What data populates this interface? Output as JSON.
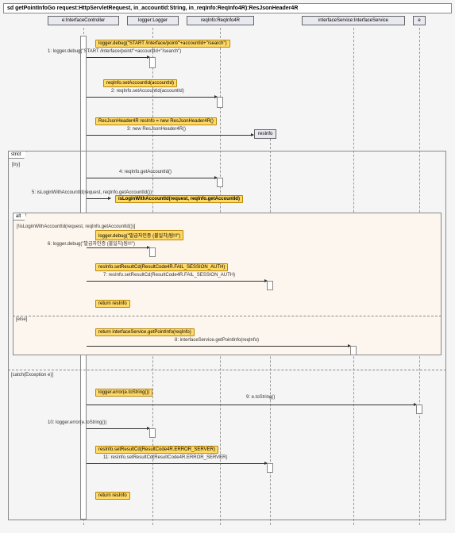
{
  "title": "sd getPointInfoGo request:HttpServletRequest, in_accountId:String, in_reqInfo:ReqInfo4R):ResJsonHeader4R",
  "lifelines": {
    "controller": "e:InterfaceController",
    "logger": "logger:Logger",
    "reqInfo": "reqInfo:ReqInfo4R",
    "service": "interfaceService:InterfaceService",
    "e": "e"
  },
  "obj_resInfo": "resInfo",
  "messages": {
    "m1_box": "logger.debug(\"START /interface/point/\"+accountId+\"/search\")",
    "m1_label": "1: logger.debug(\"START /interface/point/\"+accountId+\"/search\")",
    "m2_box": "reqInfo.setAccountId(accountId)",
    "m2_label": "2: reqInfo.setAccountId(accountId)",
    "m3_box": "ResJsonHeader4R resInfo = new ResJsonHeader4R()",
    "m3_label": "3: new ResJsonHeader4R()",
    "m4_label": "4: reqInfo.getAccountId()",
    "m5_label": "5: isLoginWithAccountId(request, reqInfo.getAccountId())",
    "m5_ref": "isLoginWithAccountId(request, reqInfo.getAccountId)",
    "m6_box": "logger.debug(\"발급자인증 (불일치)됨!!!\")",
    "m6_label": "6: logger.debug(\"발급자인증 (불일치)됨!!!\")",
    "m7_box": "resInfo.setResultCd(ResultCode4R.FAIL_SESSION_AUTH)",
    "m7_label": "7: resInfo.setResultCd(ResultCode4R.FAIL_SESSION_AUTH)",
    "m_ret1": "return resInfo",
    "m8_box": "return interfaceService.getPointInfo(reqInfo)",
    "m8_label": "8: interfaceService.getPointInfo(reqInfo)",
    "m9_box": "logger.error(e.toString())",
    "m9_text": "9: e.toString()",
    "m10_label": "10: logger.error(e.toString())",
    "m11_box": "resInfo.setResultCd(ResultCode4R.ERROR_SERVER)",
    "m11_label": "11: resInfo.setResultCd(ResultCode4R.ERROR_SERVER)",
    "m_ret2": "return resInfo"
  },
  "frames": {
    "strict": "strict",
    "try": "[try]",
    "alt": "alt",
    "alt_cond": "[!isLoginWithAccountId(request, reqInfo.getAccountId())]",
    "else": "[else]",
    "catch": "[catch(Exception e)]"
  },
  "chart_data": {
    "type": "sequence_diagram",
    "title": "sd getPointInfoGo request:HttpServletRequest, in_accountId:String, in_reqInfo:ReqInfo4R):ResJsonHeader4R",
    "lifelines": [
      "e:InterfaceController",
      "logger:Logger",
      "reqInfo:ReqInfo4R",
      "interfaceService:InterfaceService",
      "e"
    ],
    "created_objects": [
      "resInfo:ResJsonHeader4R"
    ],
    "messages": [
      {
        "n": 1,
        "from": "InterfaceController",
        "to": "Logger",
        "text": "logger.debug(\"START /interface/point/\"+accountId+\"/search\")"
      },
      {
        "n": 2,
        "from": "InterfaceController",
        "to": "ReqInfo4R",
        "text": "reqInfo.setAccountId(accountId)"
      },
      {
        "n": 3,
        "from": "InterfaceController",
        "to": "resInfo",
        "text": "new ResJsonHeader4R()",
        "kind": "create"
      },
      {
        "n": 4,
        "from": "InterfaceController",
        "to": "ReqInfo4R",
        "text": "reqInfo.getAccountId()"
      },
      {
        "n": 5,
        "from": "InterfaceController",
        "to": "InterfaceController",
        "text": "isLoginWithAccountId(request, reqInfo.getAccountId())",
        "kind": "self"
      },
      {
        "n": 6,
        "from": "InterfaceController",
        "to": "Logger",
        "text": "logger.debug(\"발급자인증 (불일치)됨!!!\")"
      },
      {
        "n": 7,
        "from": "InterfaceController",
        "to": "resInfo",
        "text": "resInfo.setResultCd(ResultCode4R.FAIL_SESSION_AUTH)"
      },
      {
        "n": "ret",
        "from": "InterfaceController",
        "text": "return resInfo",
        "kind": "return"
      },
      {
        "n": 8,
        "from": "InterfaceController",
        "to": "InterfaceService",
        "text": "interfaceService.getPointInfo(reqInfo)"
      },
      {
        "n": 9,
        "from": "InterfaceController",
        "to": "e",
        "text": "e.toString()"
      },
      {
        "n": 10,
        "from": "InterfaceController",
        "to": "Logger",
        "text": "logger.error(e.toString())"
      },
      {
        "n": 11,
        "from": "InterfaceController",
        "to": "resInfo",
        "text": "resInfo.setResultCd(ResultCode4R.ERROR_SERVER)"
      },
      {
        "n": "ret",
        "from": "InterfaceController",
        "text": "return resInfo",
        "kind": "return"
      }
    ],
    "fragments": [
      {
        "type": "strict",
        "guard": "try",
        "contains": [
          4,
          5,
          "alt"
        ]
      },
      {
        "type": "alt",
        "guards": [
          "!isLoginWithAccountId(request, reqInfo.getAccountId())",
          "else"
        ],
        "regions": [
          [
            6,
            7,
            "return resInfo"
          ],
          [
            8
          ]
        ]
      },
      {
        "type": "strict-region",
        "guard": "catch(Exception e)",
        "contains": [
          9,
          10,
          11,
          "return resInfo"
        ]
      }
    ]
  }
}
